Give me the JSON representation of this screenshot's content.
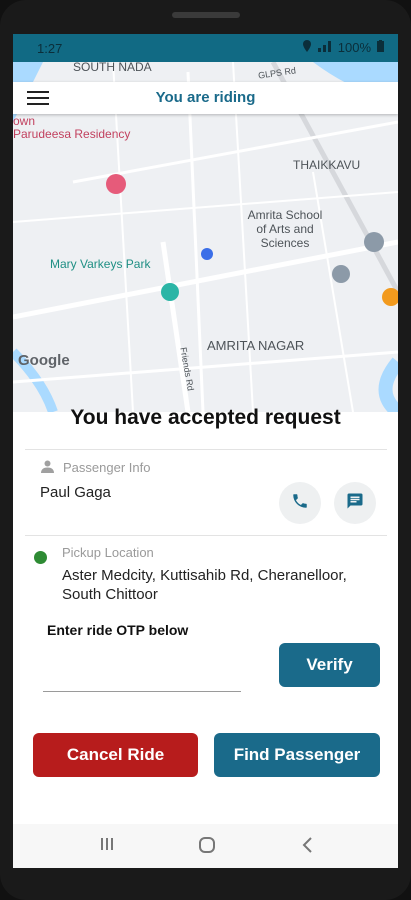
{
  "status_bar": {
    "time": "1:27",
    "battery": "100%"
  },
  "map": {
    "labels": {
      "south_nada": "SOUTH NADA",
      "residency": "Parudeesa Residency",
      "own": "own",
      "thaikkavu": "THAIKKAVU",
      "amrita_school": "Amrita School of Arts and Sciences",
      "mary_varkeys_park": "Mary Varkeys Park",
      "amrita_nagar": "AMRITA NAGAR",
      "friends_rd": "Friends Rd",
      "plus_rd": "GLPS Rd",
      "google": "Google"
    }
  },
  "header": {
    "title": "You are riding"
  },
  "card": {
    "heading": "You have accepted request",
    "passenger_info_label": "Passenger Info",
    "passenger_name": "Paul Gaga",
    "pickup_label": "Pickup Location",
    "pickup_address": "Aster Medcity, Kuttisahib Rd, Cheranelloor, South Chittoor",
    "otp_label": "Enter ride OTP below",
    "otp_value": "",
    "verify_label": "Verify",
    "cancel_label": "Cancel Ride",
    "find_label": "Find Passenger"
  },
  "colors": {
    "primary": "#1a6a8a",
    "danger": "#b71c1c",
    "status_bar": "#116a84",
    "pickup_dot": "#2e8b34"
  },
  "icons": {
    "menu": "menu-icon",
    "person": "person-icon",
    "phone": "phone-icon",
    "chat": "chat-icon"
  }
}
